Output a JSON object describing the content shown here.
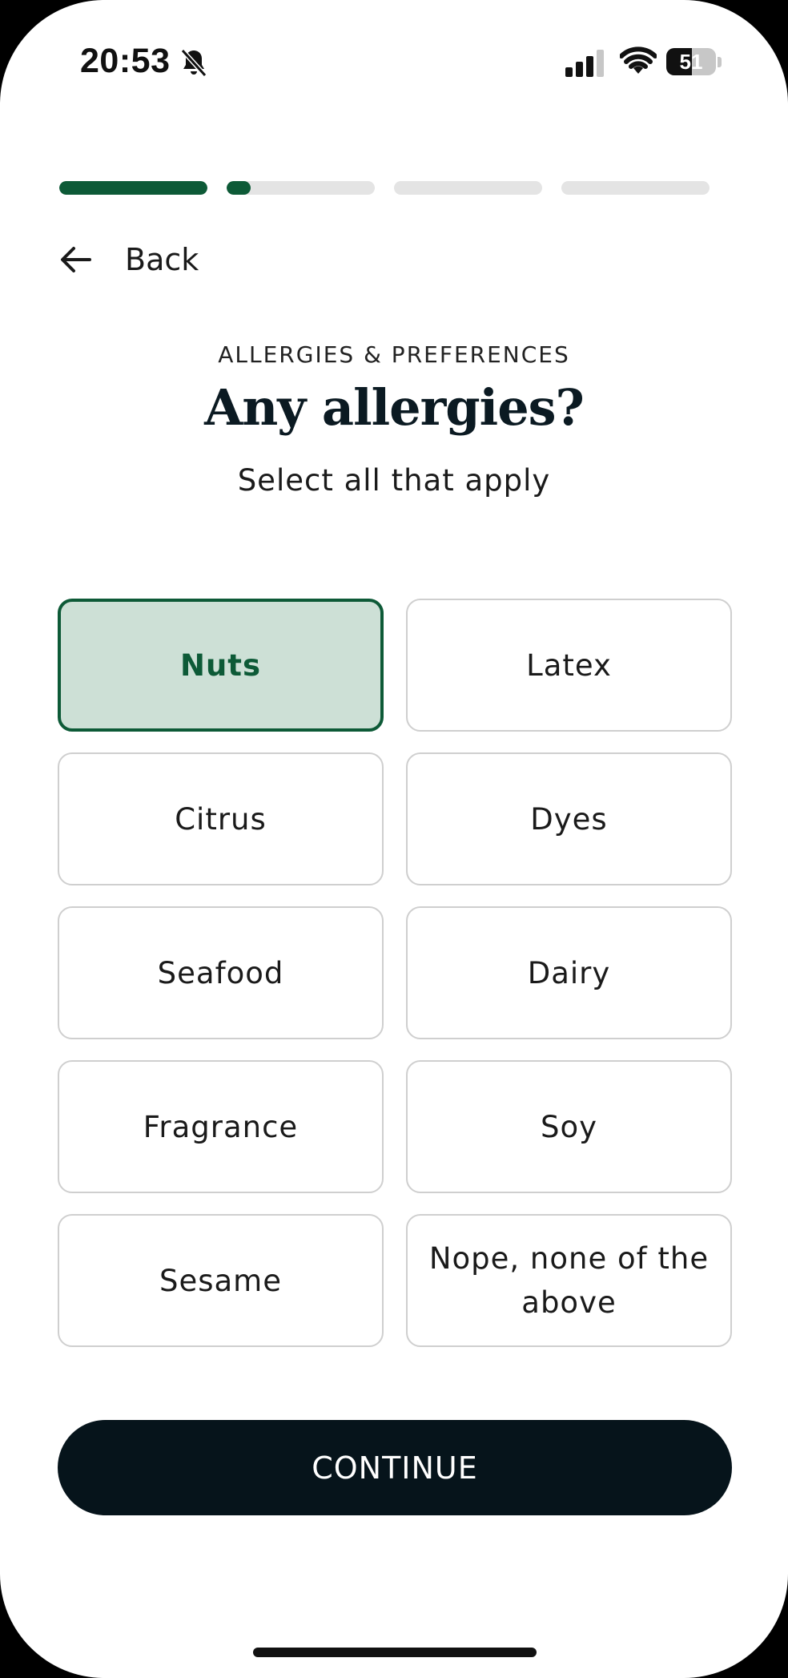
{
  "status_bar": {
    "time": "20:53",
    "battery_percent": "51",
    "battery_level": 0.51,
    "icons": [
      "bell-slash-icon",
      "signal-icon",
      "wifi-icon",
      "battery-icon"
    ]
  },
  "progress": {
    "steps": 4,
    "step_fill": [
      1.0,
      0.16,
      0,
      0
    ],
    "active_color": "#0d5a37",
    "track_color": "#e4e4e4"
  },
  "nav": {
    "back_label": "Back",
    "back_icon": "arrow-left-icon"
  },
  "header": {
    "eyebrow": "ALLERGIES & PREFERENCES",
    "title": "Any allergies?",
    "subtitle": "Select all that apply"
  },
  "options": [
    {
      "label": "Nuts",
      "selected": true
    },
    {
      "label": "Latex",
      "selected": false
    },
    {
      "label": "Citrus",
      "selected": false
    },
    {
      "label": "Dyes",
      "selected": false
    },
    {
      "label": "Seafood",
      "selected": false
    },
    {
      "label": "Dairy",
      "selected": false
    },
    {
      "label": "Fragrance",
      "selected": false
    },
    {
      "label": "Soy",
      "selected": false
    },
    {
      "label": "Sesame",
      "selected": false
    },
    {
      "label": "Nope, none of the above",
      "selected": false
    }
  ],
  "colors": {
    "selected_bg": "#cde0d6",
    "selected_border": "#0d5a37",
    "button_bg": "#06141b"
  },
  "continue_label": "CONTINUE"
}
